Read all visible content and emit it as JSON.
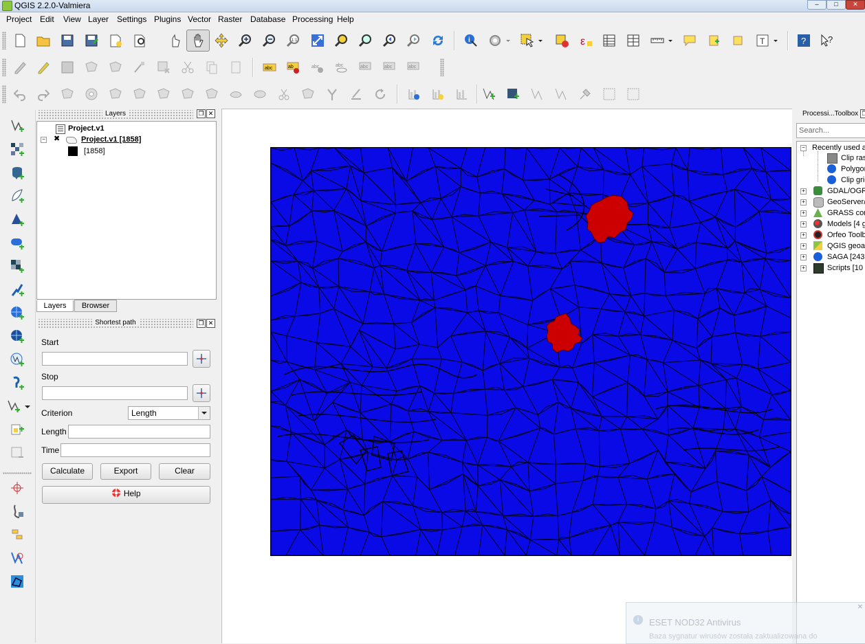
{
  "window": {
    "title": "QGIS 2.2.0-Valmiera",
    "minimize": "–",
    "maximize": "□",
    "close": "✕"
  },
  "menubar": [
    "Project",
    "Edit",
    "View",
    "Layer",
    "Settings",
    "Plugins",
    "Vector",
    "Raster",
    "Database",
    "Processing",
    "Help"
  ],
  "layers_panel": {
    "title": "Layers",
    "items": [
      {
        "label": "Project.v1"
      },
      {
        "label": "Project.v1 [1858]"
      },
      {
        "label": "[1858]"
      }
    ],
    "tabs": [
      "Layers",
      "Browser"
    ]
  },
  "shortest_path": {
    "title": "Shortest path",
    "start_label": "Start",
    "start_value": "",
    "stop_label": "Stop",
    "stop_value": "",
    "criterion_label": "Criterion",
    "criterion_value": "Length",
    "length_label": "Length",
    "length_value": "",
    "time_label": "Time",
    "time_value": "",
    "calculate": "Calculate",
    "export": "Export",
    "clear": "Clear",
    "help": "Help"
  },
  "toolbox": {
    "title": "Processi...Toolbox",
    "search_placeholder": "Search...",
    "items": [
      {
        "label": "Recently used a",
        "expanded": true,
        "icon": "folder-icon"
      },
      {
        "label": "Clip ras",
        "child": true,
        "icon": "raster-icon"
      },
      {
        "label": "Polygor",
        "child": true,
        "icon": "saga-icon"
      },
      {
        "label": "Clip grid",
        "child": true,
        "icon": "saga-icon"
      },
      {
        "label": "GDAL/OGR",
        "icon": "gdal-icon"
      },
      {
        "label": "GeoServer/",
        "icon": "database-icon"
      },
      {
        "label": "GRASS comr",
        "icon": "grass-icon"
      },
      {
        "label": "Models [4 g",
        "icon": "model-icon"
      },
      {
        "label": "Orfeo Toolb",
        "icon": "orfeo-icon"
      },
      {
        "label": "QGIS geoal",
        "icon": "qgis-icon"
      },
      {
        "label": "SAGA [243",
        "icon": "saga-icon"
      },
      {
        "label": "Scripts [10",
        "icon": "script-icon"
      }
    ]
  },
  "notification": {
    "title": "ESET NOD32 Antivirus",
    "message": "Baza sygnatur wirusów została zaktualizowana do"
  },
  "colors": {
    "map_fill": "#0a0ae6",
    "highlight": "#cc0000",
    "outline": "#000000"
  }
}
